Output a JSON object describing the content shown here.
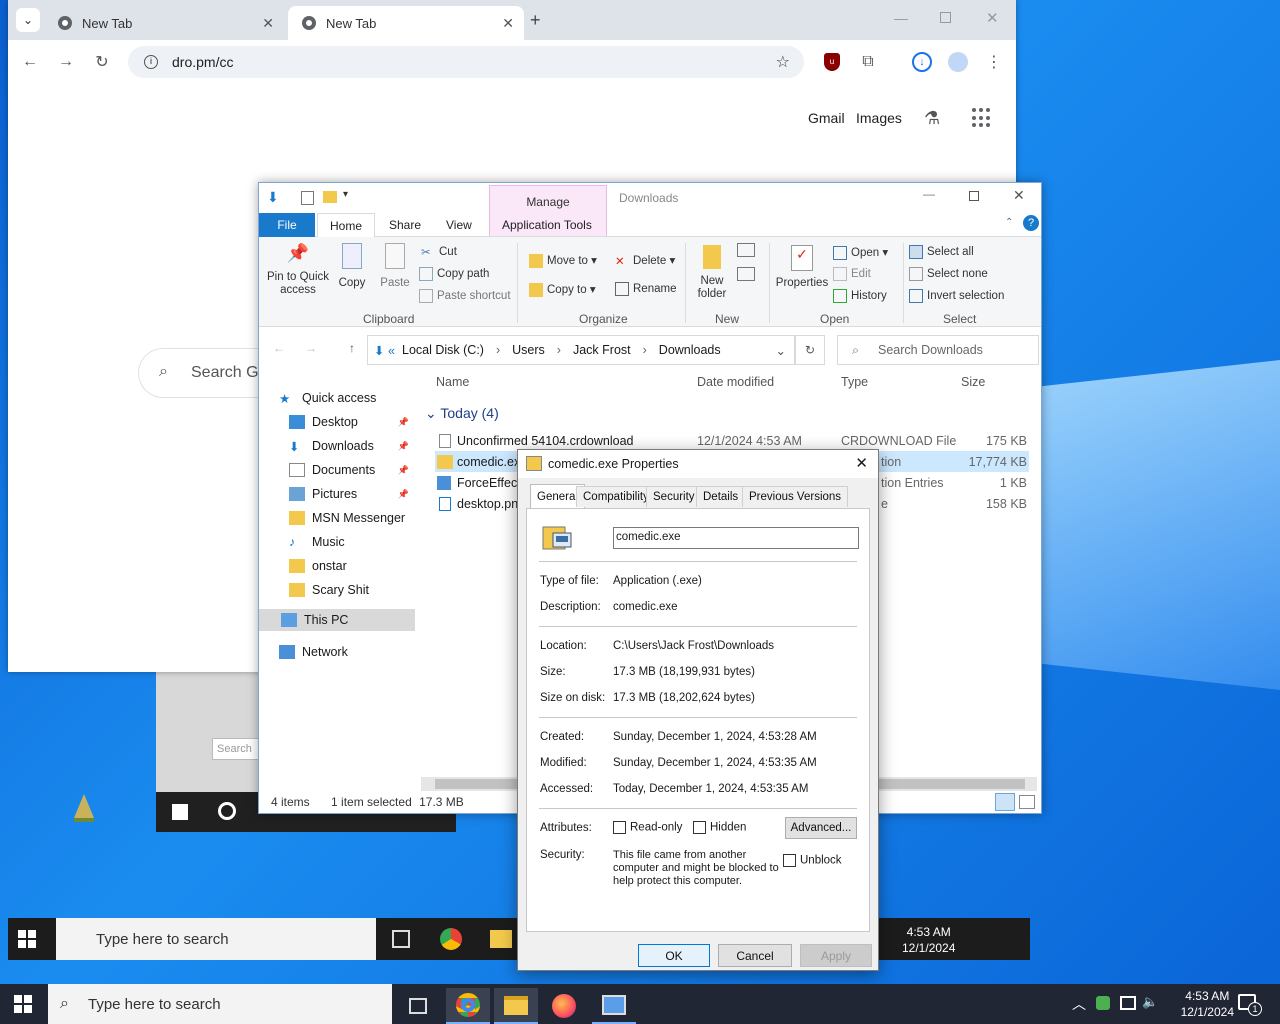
{
  "browser": {
    "tabs": [
      {
        "label": "New Tab"
      },
      {
        "label": "New Tab"
      }
    ],
    "address": "dro.pm/cc",
    "links": {
      "gmail": "Gmail",
      "images": "Images"
    },
    "search_placeholder": "Search Go"
  },
  "explorer": {
    "title": "Downloads",
    "contextual_tab": "Manage",
    "ribbon_tabs": [
      "File",
      "Home",
      "Share",
      "View",
      "Application Tools"
    ],
    "clipboard": {
      "pin": "Pin to Quick access",
      "copy": "Copy",
      "paste": "Paste",
      "cut": "Cut",
      "copy_path": "Copy path",
      "paste_shortcut": "Paste shortcut",
      "group": "Clipboard"
    },
    "organize": {
      "move_to": "Move to",
      "copy_to": "Copy to",
      "delete": "Delete",
      "rename": "Rename",
      "group": "Organize"
    },
    "new": {
      "new_folder": "New folder",
      "group": "New"
    },
    "open": {
      "properties": "Properties",
      "open": "Open",
      "edit": "Edit",
      "history": "History",
      "group": "Open"
    },
    "select": {
      "select_all": "Select all",
      "select_none": "Select none",
      "invert": "Invert selection",
      "group": "Select"
    },
    "breadcrumb": [
      "Local Disk (C:)",
      "Users",
      "Jack Frost",
      "Downloads"
    ],
    "search_placeholder": "Search Downloads",
    "nav": [
      {
        "label": "Quick access"
      },
      {
        "label": "Desktop",
        "pinned": true
      },
      {
        "label": "Downloads",
        "pinned": true
      },
      {
        "label": "Documents",
        "pinned": true
      },
      {
        "label": "Pictures",
        "pinned": true
      },
      {
        "label": "MSN Messenger"
      },
      {
        "label": "Music"
      },
      {
        "label": "onstar"
      },
      {
        "label": "Scary Shit"
      },
      {
        "label": "This PC"
      },
      {
        "label": "Network"
      }
    ],
    "columns": {
      "name": "Name",
      "date": "Date modified",
      "type": "Type",
      "size": "Size"
    },
    "group_header": "Today (4)",
    "files": [
      {
        "name": "Unconfirmed 54104.crdownload",
        "date": "12/1/2024 4:53 AM",
        "type": "CRDOWNLOAD File",
        "size": "175 KB"
      },
      {
        "name": "comedic.ex",
        "date": "",
        "type": "tion",
        "size": "17,774 KB"
      },
      {
        "name": "ForceEffect",
        "date": "",
        "type": "tion Entries",
        "size": "1 KB"
      },
      {
        "name": "desktop.pn",
        "date": "",
        "type": "e",
        "size": "158 KB"
      }
    ],
    "status": {
      "items": "4 items",
      "selected": "1 item selected",
      "size": "17.3 MB"
    }
  },
  "dialog": {
    "title": "comedic.exe Properties",
    "tabs": [
      "General",
      "Compatibility",
      "Security",
      "Details",
      "Previous Versions"
    ],
    "filename": "comedic.exe",
    "rows": {
      "type_label": "Type of file:",
      "type_value": "Application (.exe)",
      "desc_label": "Description:",
      "desc_value": "comedic.exe",
      "loc_label": "Location:",
      "loc_value": "C:\\Users\\Jack Frost\\Downloads",
      "size_label": "Size:",
      "size_value": "17.3 MB (18,199,931 bytes)",
      "sod_label": "Size on disk:",
      "sod_value": "17.3 MB (18,202,624 bytes)",
      "created_label": "Created:",
      "created_value": "Sunday, December 1, 2024, 4:53:28 AM",
      "modified_label": "Modified:",
      "modified_value": "Sunday, December 1, 2024, 4:53:35 AM",
      "accessed_label": "Accessed:",
      "accessed_value": "Today, December 1, 2024, 4:53:35 AM",
      "attr_label": "Attributes:",
      "readonly": "Read-only",
      "hidden": "Hidden",
      "advanced": "Advanced...",
      "security_label": "Security:",
      "security_text": "This file came from another computer and might be blocked to help protect this computer.",
      "unblock": "Unblock"
    },
    "buttons": {
      "ok": "OK",
      "cancel": "Cancel",
      "apply": "Apply"
    }
  },
  "inner_taskbar": {
    "search": "Type here to search",
    "time": "4:53 AM",
    "date": "12/1/2024"
  },
  "taskbar": {
    "search": "Type here to search",
    "time": "4:53 AM",
    "date": "12/1/2024",
    "badge": "1"
  },
  "old_window": {
    "search": "Search"
  }
}
